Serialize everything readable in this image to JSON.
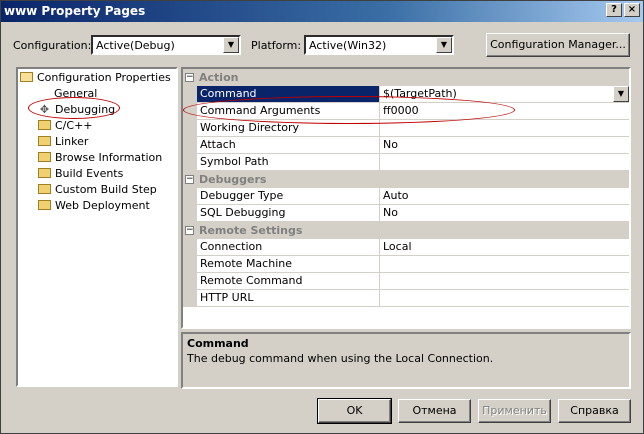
{
  "window": {
    "title": "www Property Pages",
    "help_glyph": "?",
    "close_glyph": "×"
  },
  "toolbar": {
    "configuration_label": "Configuration:",
    "configuration_value": "Active(Debug)",
    "platform_label": "Platform:",
    "platform_value": "Active(Win32)",
    "config_manager_label": "Configuration Manager..."
  },
  "tree": {
    "root": "Configuration Properties",
    "items": [
      "General",
      "Debugging",
      "C/C++",
      "Linker",
      "Browse Information",
      "Build Events",
      "Custom Build Step",
      "Web Deployment"
    ],
    "selected": "Debugging"
  },
  "grid": {
    "categories": {
      "action": "Action",
      "debuggers": "Debuggers",
      "remote": "Remote Settings"
    },
    "rows": {
      "command": {
        "name": "Command",
        "value": "$(TargetPath)"
      },
      "command_arguments": {
        "name": "Command Arguments",
        "value": "ff0000"
      },
      "working_directory": {
        "name": "Working Directory",
        "value": ""
      },
      "attach": {
        "name": "Attach",
        "value": "No"
      },
      "symbol_path": {
        "name": "Symbol Path",
        "value": ""
      },
      "debugger_type": {
        "name": "Debugger Type",
        "value": "Auto"
      },
      "sql_debugging": {
        "name": "SQL Debugging",
        "value": "No"
      },
      "connection": {
        "name": "Connection",
        "value": "Local"
      },
      "remote_machine": {
        "name": "Remote Machine",
        "value": ""
      },
      "remote_command": {
        "name": "Remote Command",
        "value": ""
      },
      "http_url": {
        "name": "HTTP URL",
        "value": ""
      }
    }
  },
  "description": {
    "title": "Command",
    "text": "The debug command when using the Local Connection."
  },
  "buttons": {
    "ok": "OK",
    "cancel": "Отмена",
    "apply": "Применить",
    "help": "Справка"
  },
  "colors": {
    "selection": "#0a246a",
    "annotation": "#c00000",
    "face": "#d4d0c8"
  }
}
